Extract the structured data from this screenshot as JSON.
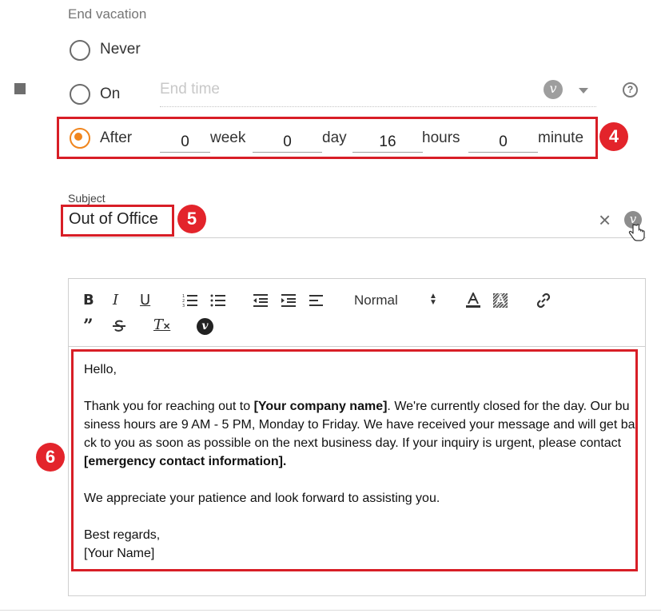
{
  "end_vacation": {
    "section_label": "End vacation",
    "options": {
      "never": "Never",
      "on": "On",
      "after": "After"
    },
    "selected": "after",
    "end_time_placeholder": "End time",
    "after_fields": {
      "weeks": "0",
      "weeks_unit": "week",
      "days": "0",
      "days_unit": "day",
      "hours": "16",
      "hours_unit": "hours",
      "minutes": "0",
      "minutes_unit": "minute"
    }
  },
  "subject": {
    "label": "Subject",
    "value": "Out of Office"
  },
  "editor": {
    "toolbar": {
      "bold": "B",
      "italic": "I",
      "underline": "U",
      "format_select": "Normal"
    },
    "body": {
      "greeting": "Hello,",
      "p1_pre": "Thank you for reaching out to ",
      "p1_bold1": "[Your company name]",
      "p1_mid": ". We're currently closed for the day. Our business hours are 9 AM - 5 PM, Monday to Friday. We have received your message and will get back to you as soon as possible on the next business day. If your inquiry is urgent, please contact ",
      "p1_bold2": "[emergency contact information].",
      "p2": "We appreciate your patience and look forward to assisting you.",
      "closing": "Best regards,",
      "signature": "[Your Name]"
    }
  },
  "annotations": {
    "badge_4": "4",
    "badge_5": "5",
    "badge_6": "6",
    "highlight_color": "#d81e26"
  },
  "icons": {
    "variable": "v",
    "help": "?",
    "clear": "×"
  },
  "colors": {
    "radio_selected": "#f0851d",
    "badge_fill": "#e3242b"
  }
}
